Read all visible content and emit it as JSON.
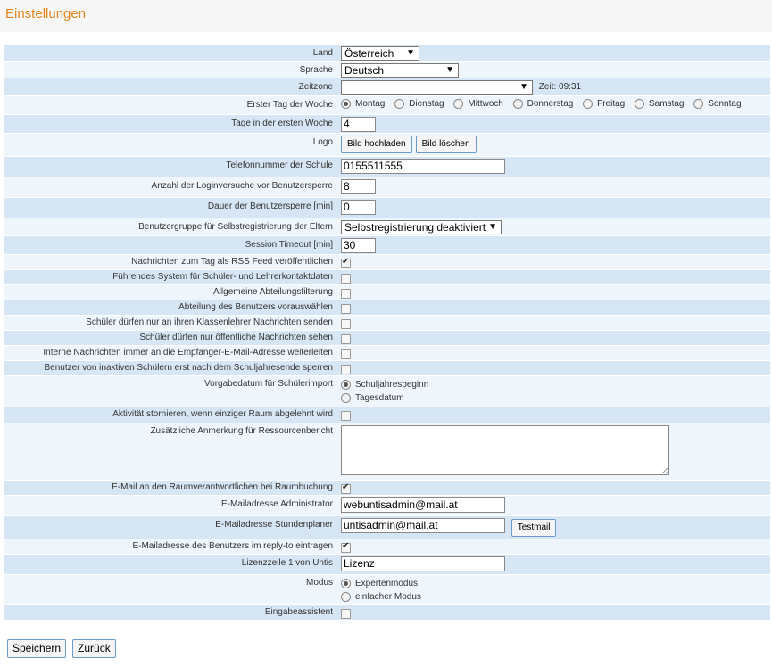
{
  "header": {
    "title": "Einstellungen"
  },
  "form": {
    "land": {
      "label": "Land",
      "value": "Österreich"
    },
    "sprache": {
      "label": "Sprache",
      "value": "Deutsch"
    },
    "zeitzone": {
      "label": "Zeitzone",
      "value": "",
      "time": "Zeit: 09:31"
    },
    "erster_tag": {
      "label": "Erster Tag der Woche",
      "options": [
        "Montag",
        "Dienstag",
        "Mittwoch",
        "Donnerstag",
        "Freitag",
        "Samstag",
        "Sonntag"
      ],
      "selected": "Montag"
    },
    "tage_erste_woche": {
      "label": "Tage in der ersten Woche",
      "value": "4"
    },
    "logo": {
      "label": "Logo",
      "upload": "Bild hochladen",
      "delete": "Bild löschen"
    },
    "telefon": {
      "label": "Telefonnummer der Schule",
      "value": "0155511555"
    },
    "loginversuche": {
      "label": "Anzahl der Loginversuche vor Benutzersperre",
      "value": "8"
    },
    "sperrdauer": {
      "label": "Dauer der Benutzersperre [min]",
      "value": "0"
    },
    "benutzergruppe": {
      "label": "Benutzergruppe für Selbstregistrierung der Eltern",
      "value": "Selbstregistrierung deaktiviert"
    },
    "session_timeout": {
      "label": "Session Timeout [min]",
      "value": "30"
    },
    "rss": {
      "label": "Nachrichten zum Tag als RSS Feed veröffentlichen",
      "checked": true
    },
    "fuehrendes_system": {
      "label": "Führendes System für Schüler- und Lehrerkontaktdaten",
      "checked": false
    },
    "abteilungsfilterung": {
      "label": "Allgemeine Abteilungsfilterung",
      "checked": false
    },
    "abteilung_vorauswaehlen": {
      "label": "Abteilung des Benutzers vorauswählen",
      "checked": false
    },
    "klassenlehrer_nachrichten": {
      "label": "Schüler dürfen nur an ihren Klassenlehrer Nachrichten senden",
      "checked": false
    },
    "oeffentliche_nachrichten": {
      "label": "Schüler dürfen nur öffentliche Nachrichten sehen",
      "checked": false
    },
    "interne_weiterleiten": {
      "label": "Interne Nachrichten immer an die Empfänger-E-Mail-Adresse weiterleiten",
      "checked": false
    },
    "inaktive_sperren": {
      "label": "Benutzer von inaktiven Schülern erst nach dem Schuljahresende sperren",
      "checked": false
    },
    "vorgabedatum": {
      "label": "Vorgabedatum für Schülerimport",
      "options": [
        "Schuljahresbeginn",
        "Tagesdatum"
      ],
      "selected": "Schuljahresbeginn"
    },
    "aktivitaet_stornieren": {
      "label": "Aktivität stornieren, wenn einziger Raum abgelehnt wird",
      "checked": false
    },
    "anmerkung": {
      "label": "Zusätzliche Anmerkung für Ressourcenbericht",
      "value": ""
    },
    "email_raumverantwortliche": {
      "label": "E-Mail an den Raumverantwortlichen bei Raumbuchung",
      "checked": true
    },
    "email_admin": {
      "label": "E-Mailadresse Administrator",
      "value": "webuntisadmin@mail.at"
    },
    "email_stundenplaner": {
      "label": "E-Mailadresse Stundenplaner",
      "value": "untisadmin@mail.at",
      "testmail": "Testmail"
    },
    "reply_to": {
      "label": "E-Mailadresse des Benutzers im reply-to eintragen",
      "checked": true
    },
    "lizenzzeile": {
      "label": "Lizenzzeile 1 von Untis",
      "value": "Lizenz"
    },
    "modus": {
      "label": "Modus",
      "options": [
        "Expertenmodus",
        "einfacher Modus"
      ],
      "selected": "Expertenmodus"
    },
    "eingabeassistent": {
      "label": "Eingabeassistent",
      "checked": false
    }
  },
  "footer": {
    "save": "Speichern",
    "back": "Zurück"
  }
}
